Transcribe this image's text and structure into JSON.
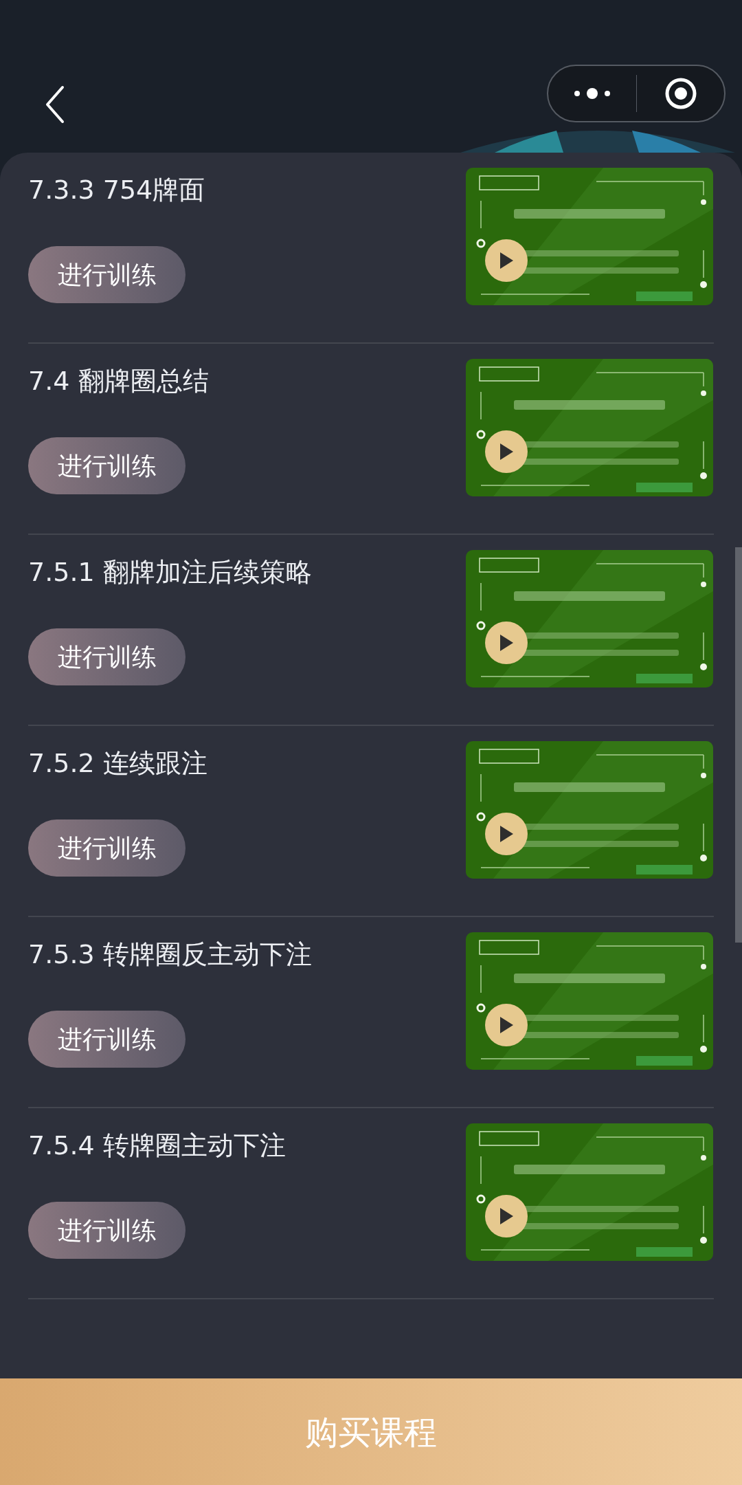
{
  "lessons": [
    {
      "title": "7.3.3 754牌面",
      "button": "进行训练"
    },
    {
      "title": "7.4 翻牌圈总结",
      "button": "进行训练"
    },
    {
      "title": "7.5.1 翻牌加注后续策略",
      "button": "进行训练"
    },
    {
      "title": "7.5.2 连续跟注",
      "button": "进行训练"
    },
    {
      "title": "7.5.3 转牌圈反主动下注",
      "button": "进行训练"
    },
    {
      "title": "7.5.4 转牌圈主动下注",
      "button": "进行训练"
    }
  ],
  "buy_button": "购买课程"
}
